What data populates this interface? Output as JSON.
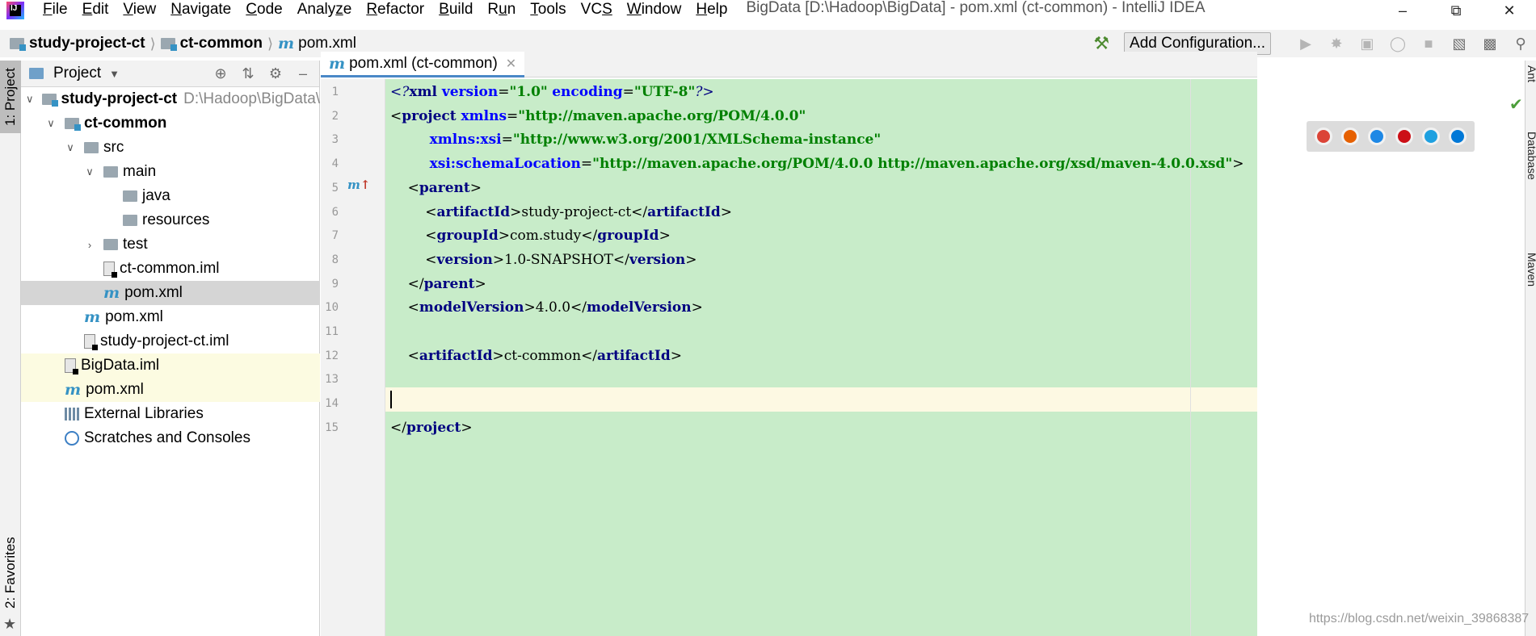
{
  "menubar": {
    "items": [
      {
        "label": "File",
        "mnemonic": "F"
      },
      {
        "label": "Edit",
        "mnemonic": "E"
      },
      {
        "label": "View",
        "mnemonic": "V"
      },
      {
        "label": "Navigate",
        "mnemonic": "N"
      },
      {
        "label": "Code",
        "mnemonic": "C"
      },
      {
        "label": "Analyze",
        "mnemonic": "z"
      },
      {
        "label": "Refactor",
        "mnemonic": "R"
      },
      {
        "label": "Build",
        "mnemonic": "B"
      },
      {
        "label": "Run",
        "mnemonic": "u"
      },
      {
        "label": "Tools",
        "mnemonic": "T"
      },
      {
        "label": "VCS",
        "mnemonic": "S"
      },
      {
        "label": "Window",
        "mnemonic": "W"
      },
      {
        "label": "Help",
        "mnemonic": "H"
      }
    ],
    "window_title": "BigData [D:\\Hadoop\\BigData] - pom.xml (ct-common) - IntelliJ IDEA",
    "window_controls": [
      "minimize-icon",
      "restore-icon",
      "close-icon"
    ]
  },
  "navbar": {
    "crumbs": [
      "study-project-ct",
      "ct-common",
      "pom.xml"
    ],
    "add_configuration": "Add Configuration...",
    "toolbar_icons": [
      "run-icon",
      "debug-icon",
      "run-with-coverage-icon",
      "profile-icon",
      "stop-icon",
      "project-structure-icon",
      "terminal-icon",
      "search-everywhere-icon"
    ]
  },
  "left_strip": {
    "project_tab": "1: Project",
    "favorites_tab": "2: Favorites"
  },
  "project_panel": {
    "title": "Project",
    "tree": [
      {
        "label": "study-project-ct",
        "extra": "D:\\Hadoop\\BigData\\study-",
        "icon": "module-folder",
        "depth": 0,
        "arrow": "down",
        "bold": true
      },
      {
        "label": "ct-common",
        "icon": "module-folder",
        "depth": 1,
        "arrow": "down",
        "bold": true
      },
      {
        "label": "src",
        "icon": "folder",
        "depth": 2,
        "arrow": "down"
      },
      {
        "label": "main",
        "icon": "folder",
        "depth": 3,
        "arrow": "down"
      },
      {
        "label": "java",
        "icon": "folder",
        "depth": 4,
        "arrow": "none"
      },
      {
        "label": "resources",
        "icon": "folder",
        "depth": 4,
        "arrow": "none"
      },
      {
        "label": "test",
        "icon": "folder",
        "depth": 3,
        "arrow": "right"
      },
      {
        "label": "ct-common.iml",
        "icon": "iml",
        "depth": 3,
        "arrow": "none"
      },
      {
        "label": "pom.xml",
        "icon": "maven",
        "depth": 3,
        "arrow": "none",
        "selected": true
      },
      {
        "label": "pom.xml",
        "icon": "maven",
        "depth": 2,
        "arrow": "none"
      },
      {
        "label": "study-project-ct.iml",
        "icon": "iml",
        "depth": 2,
        "arrow": "none"
      },
      {
        "label": "BigData.iml",
        "icon": "iml",
        "depth": 1,
        "arrow": "none",
        "highlight": true
      },
      {
        "label": "pom.xml",
        "icon": "maven",
        "depth": 1,
        "arrow": "none",
        "highlight": true
      },
      {
        "label": "External Libraries",
        "icon": "libs",
        "depth": 1,
        "arrow": "none"
      },
      {
        "label": "Scratches and Consoles",
        "icon": "scratch",
        "depth": 1,
        "arrow": "none"
      }
    ]
  },
  "editor": {
    "tab_label": "pom.xml (ct-common)",
    "line_numbers": [
      "1",
      "2",
      "3",
      "4",
      "5",
      "6",
      "7",
      "8",
      "9",
      "10",
      "11",
      "12",
      "13",
      "14",
      "15"
    ],
    "lines": [
      [
        {
          "t": "<?",
          "c": "t-pi"
        },
        {
          "t": "xml ",
          "c": "t-tag"
        },
        {
          "t": "version",
          "c": "t-attr"
        },
        {
          "t": "=",
          "c": "t-text"
        },
        {
          "t": "\"1.0\"",
          "c": "t-val"
        },
        {
          "t": " ",
          "c": "t-text"
        },
        {
          "t": "encoding",
          "c": "t-attr"
        },
        {
          "t": "=",
          "c": "t-text"
        },
        {
          "t": "\"UTF-8\"",
          "c": "t-val"
        },
        {
          "t": "?>",
          "c": "t-pi"
        }
      ],
      [
        {
          "t": "<",
          "c": "t-bracket"
        },
        {
          "t": "project ",
          "c": "t-tag"
        },
        {
          "t": "xmlns",
          "c": "t-attr"
        },
        {
          "t": "=",
          "c": "t-text"
        },
        {
          "t": "\"http://maven.apache.org/POM/4.0.0\"",
          "c": "t-val"
        }
      ],
      [
        {
          "t": "         ",
          "c": "t-text"
        },
        {
          "t": "xmlns:xsi",
          "c": "t-attr"
        },
        {
          "t": "=",
          "c": "t-text"
        },
        {
          "t": "\"http://www.w3.org/2001/XMLSchema-instance\"",
          "c": "t-val"
        }
      ],
      [
        {
          "t": "         ",
          "c": "t-text"
        },
        {
          "t": "xsi:schemaLocation",
          "c": "t-attr"
        },
        {
          "t": "=",
          "c": "t-text"
        },
        {
          "t": "\"http://maven.apache.org/POM/4.0.0 http://maven.apache.org/xsd/maven-4.0.0.xsd\"",
          "c": "t-val"
        },
        {
          "t": ">",
          "c": "t-bracket"
        }
      ],
      [
        {
          "t": "    ",
          "c": "t-text"
        },
        {
          "t": "<",
          "c": "t-bracket"
        },
        {
          "t": "parent",
          "c": "t-tag"
        },
        {
          "t": ">",
          "c": "t-bracket"
        }
      ],
      [
        {
          "t": "        ",
          "c": "t-text"
        },
        {
          "t": "<",
          "c": "t-bracket"
        },
        {
          "t": "artifactId",
          "c": "t-tag"
        },
        {
          "t": ">",
          "c": "t-bracket"
        },
        {
          "t": "study-project-ct",
          "c": "t-text"
        },
        {
          "t": "</",
          "c": "t-bracket"
        },
        {
          "t": "artifactId",
          "c": "t-tag"
        },
        {
          "t": ">",
          "c": "t-bracket"
        }
      ],
      [
        {
          "t": "        ",
          "c": "t-text"
        },
        {
          "t": "<",
          "c": "t-bracket"
        },
        {
          "t": "groupId",
          "c": "t-tag"
        },
        {
          "t": ">",
          "c": "t-bracket"
        },
        {
          "t": "com.study",
          "c": "t-text"
        },
        {
          "t": "</",
          "c": "t-bracket"
        },
        {
          "t": "groupId",
          "c": "t-tag"
        },
        {
          "t": ">",
          "c": "t-bracket"
        }
      ],
      [
        {
          "t": "        ",
          "c": "t-text"
        },
        {
          "t": "<",
          "c": "t-bracket"
        },
        {
          "t": "version",
          "c": "t-tag"
        },
        {
          "t": ">",
          "c": "t-bracket"
        },
        {
          "t": "1.0-SNAPSHOT",
          "c": "t-text"
        },
        {
          "t": "</",
          "c": "t-bracket"
        },
        {
          "t": "version",
          "c": "t-tag"
        },
        {
          "t": ">",
          "c": "t-bracket"
        }
      ],
      [
        {
          "t": "    ",
          "c": "t-text"
        },
        {
          "t": "</",
          "c": "t-bracket"
        },
        {
          "t": "parent",
          "c": "t-tag"
        },
        {
          "t": ">",
          "c": "t-bracket"
        }
      ],
      [
        {
          "t": "    ",
          "c": "t-text"
        },
        {
          "t": "<",
          "c": "t-bracket"
        },
        {
          "t": "modelVersion",
          "c": "t-tag"
        },
        {
          "t": ">",
          "c": "t-bracket"
        },
        {
          "t": "4.0.0",
          "c": "t-text"
        },
        {
          "t": "</",
          "c": "t-bracket"
        },
        {
          "t": "modelVersion",
          "c": "t-tag"
        },
        {
          "t": ">",
          "c": "t-bracket"
        }
      ],
      [],
      [
        {
          "t": "    ",
          "c": "t-text"
        },
        {
          "t": "<",
          "c": "t-bracket"
        },
        {
          "t": "artifactId",
          "c": "t-tag"
        },
        {
          "t": ">",
          "c": "t-bracket"
        },
        {
          "t": "ct-common",
          "c": "t-text"
        },
        {
          "t": "</",
          "c": "t-bracket"
        },
        {
          "t": "artifactId",
          "c": "t-tag"
        },
        {
          "t": ">",
          "c": "t-bracket"
        }
      ],
      [],
      [],
      [
        {
          "t": "</",
          "c": "t-bracket"
        },
        {
          "t": "project",
          "c": "t-tag"
        },
        {
          "t": ">",
          "c": "t-bracket"
        }
      ]
    ],
    "caret_line": "14",
    "browsers": [
      {
        "name": "chrome-icon",
        "color": "#db4437"
      },
      {
        "name": "firefox-icon",
        "color": "#e66000"
      },
      {
        "name": "safari-icon",
        "color": "#1e88e5"
      },
      {
        "name": "opera-icon",
        "color": "#cc0f16"
      },
      {
        "name": "ie-icon",
        "color": "#1ea0e0"
      },
      {
        "name": "edge-icon",
        "color": "#0078d7"
      }
    ]
  },
  "right_strip": {
    "tabs": [
      "Ant",
      "Database",
      "Maven"
    ]
  },
  "watermark": "https://blog.csdn.net/weixin_39868387",
  "colors": {
    "code_background": "#c8ecc9",
    "caret_line": "#fdf9e3",
    "selection": "#d5d5d5",
    "highlight_row": "#fcfbe1",
    "maven_blue": "#3592c4"
  }
}
